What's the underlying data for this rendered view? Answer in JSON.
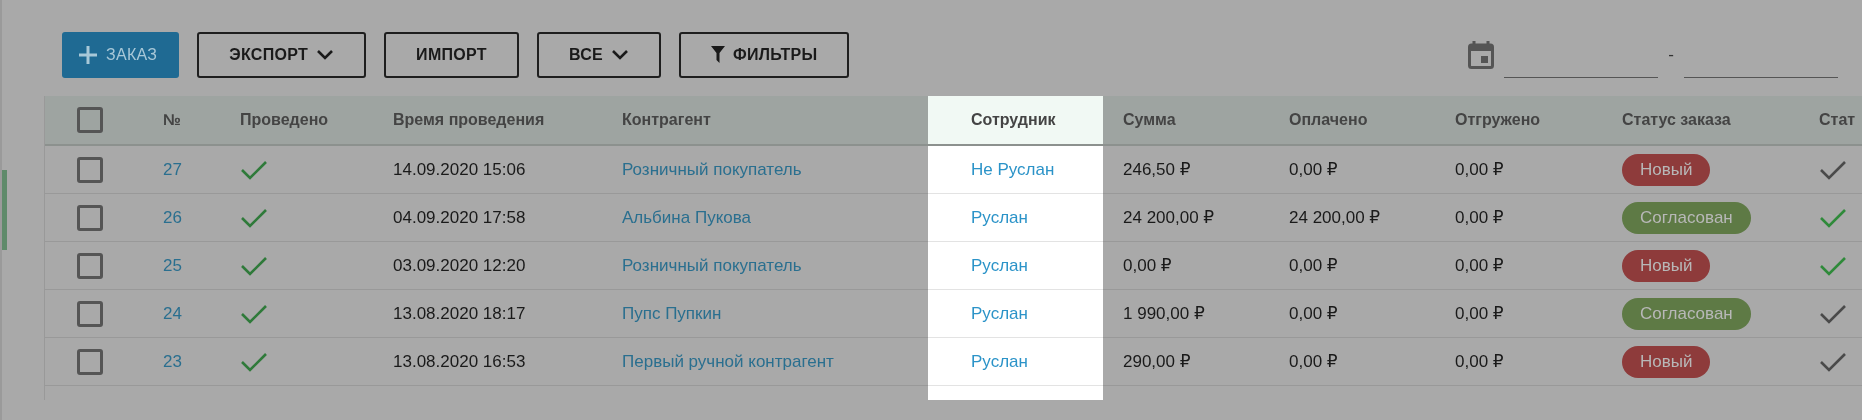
{
  "toolbar": {
    "buttons": [
      {
        "label": "ЗАКАЗ",
        "kind": "primary"
      },
      {
        "label": "ЭКСПОРТ",
        "kind": "dropdown"
      },
      {
        "label": "ИМПОРТ",
        "kind": "plain"
      },
      {
        "label": "ВСЕ",
        "kind": "dropdown"
      },
      {
        "label": "ФИЛЬТРЫ",
        "kind": "filter"
      }
    ],
    "date_range": {
      "separator": "-"
    }
  },
  "table": {
    "select_all_checked": false,
    "columns": [
      {
        "label": "№",
        "highlighted": false
      },
      {
        "label": "Проведено",
        "highlighted": false
      },
      {
        "label": "Время проведения",
        "highlighted": false
      },
      {
        "label": "Контрагент",
        "highlighted": false
      },
      {
        "label": "Сотрудник",
        "highlighted": true
      },
      {
        "label": "Сумма",
        "highlighted": false
      },
      {
        "label": "Оплачено",
        "highlighted": false
      },
      {
        "label": "Отгружено",
        "highlighted": false
      },
      {
        "label": "Статус заказа",
        "highlighted": false
      },
      {
        "label": "Стат",
        "highlighted": false
      }
    ],
    "rows": [
      {
        "checked": false,
        "number": "27",
        "posted": true,
        "time": "14.09.2020 15:06",
        "counterparty": "Розничный покупатель",
        "employee": "Не Руслан",
        "sum": "246,50 ₽",
        "paid": "0,00 ₽",
        "shipped": "0,00 ₽",
        "status": {
          "label": "Новый",
          "color": "#8e3b3b"
        },
        "column_10_done": false
      },
      {
        "checked": false,
        "number": "26",
        "posted": true,
        "time": "04.09.2020 17:58",
        "counterparty": "Альбина Пукова",
        "employee": "Руслан",
        "sum": "24 200,00 ₽",
        "paid": "24 200,00 ₽",
        "shipped": "0,00 ₽",
        "status": {
          "label": "Согласован",
          "color": "#5e7a45"
        },
        "column_10_done": true
      },
      {
        "checked": false,
        "number": "25",
        "posted": true,
        "time": "03.09.2020 12:20",
        "counterparty": "Розничный покупатель",
        "employee": "Руслан",
        "sum": "0,00 ₽",
        "paid": "0,00 ₽",
        "shipped": "0,00 ₽",
        "status": {
          "label": "Новый",
          "color": "#8e3b3b"
        },
        "column_10_done": true
      },
      {
        "checked": false,
        "number": "24",
        "posted": true,
        "time": "13.08.2020 18:17",
        "counterparty": "Пупс Пупкин",
        "employee": "Руслан",
        "sum": "1 990,00 ₽",
        "paid": "0,00 ₽",
        "shipped": "0,00 ₽",
        "status": {
          "label": "Согласован",
          "color": "#5e7a45"
        },
        "column_10_done": false
      },
      {
        "checked": false,
        "number": "23",
        "posted": true,
        "time": "13.08.2020 16:53",
        "counterparty": "Первый ручной контрагент",
        "employee": "Руслан",
        "sum": "290,00 ₽",
        "paid": "0,00 ₽",
        "shipped": "0,00 ₽",
        "status": {
          "label": "Новый",
          "color": "#8e3b3b"
        },
        "column_10_done": false
      }
    ]
  }
}
